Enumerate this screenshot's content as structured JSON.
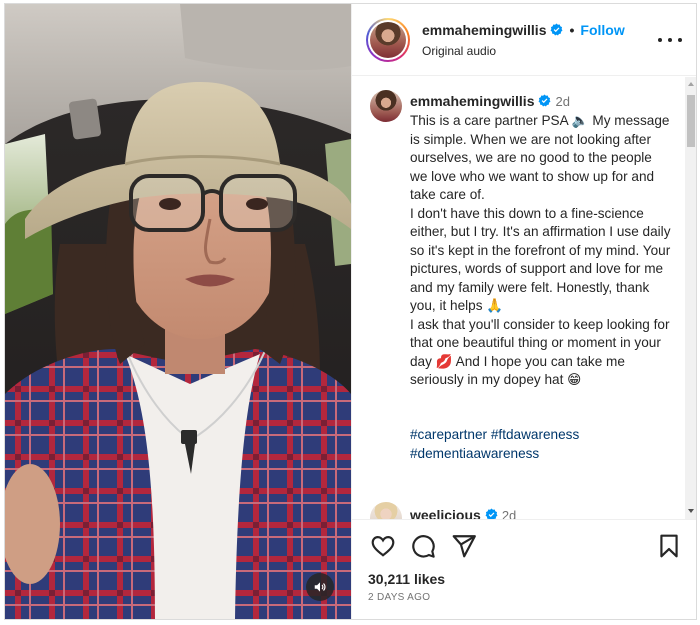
{
  "post": {
    "username": "emmahemingwillis",
    "follow_label": "Follow",
    "separator": "•",
    "audio_label": "Original audio"
  },
  "caption": {
    "username": "emmahemingwillis",
    "time": "2d",
    "lines": [
      "This is a care partner PSA 🔈 My message is simple. When we are not looking after ourselves, we are no good to the people we love who we want to show up for and take care of.",
      "I don't have this down to a fine-science either, but I try. It's an affirmation I use daily so it's kept in the forefront of my mind.  Your pictures, words of support and love for me and my family were felt. Honestly, thank you, it helps 🙏",
      "I ask that you'll consider to keep looking for that one beautiful thing or moment in your day 💋 And I hope you can take me seriously in my dopey hat 😁"
    ],
    "hashtags": [
      "#carepartner",
      "#ftdawareness",
      "#dementiaawareness"
    ]
  },
  "comment2": {
    "username": "weelicious",
    "time": "2d"
  },
  "actions": {
    "like_icon": "heart-icon",
    "comment_icon": "comment-icon",
    "share_icon": "share-icon",
    "save_icon": "bookmark-icon",
    "likes": "30,211 likes",
    "posted_ago": "2 DAYS AGO"
  },
  "video": {
    "audio_icon": "speaker-icon"
  },
  "colors": {
    "link": "#0095f6",
    "hashtag": "#00376b",
    "verified": "#0095f6",
    "muted": "#737373"
  }
}
